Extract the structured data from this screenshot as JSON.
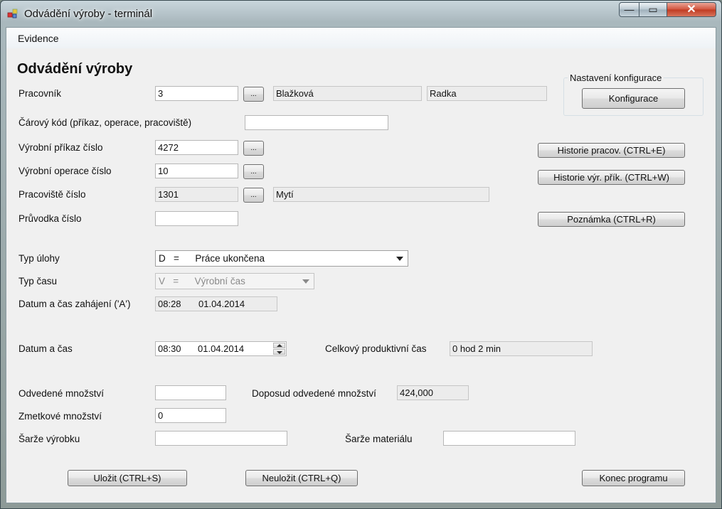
{
  "window": {
    "title": "Odvádění výroby - terminál",
    "controls": {
      "minimize": "—",
      "maximize": "▭",
      "close": "✕"
    },
    "icon": "app-window-icon"
  },
  "menu": {
    "items": [
      {
        "label": "Evidence"
      }
    ]
  },
  "form": {
    "title": "Odvádění výroby",
    "pracovnik": {
      "label": "Pracovník",
      "value": "3",
      "browse": "...",
      "surname": "Blažková",
      "first_name": "Radka"
    },
    "carovy_kod": {
      "label": "Čárový kód (příkaz, operace, pracoviště)",
      "value": ""
    },
    "vyrobni_prikaz": {
      "label": "Výrobní příkaz číslo",
      "value": "4272",
      "browse": "..."
    },
    "vyrobni_operace": {
      "label": "Výrobní operace číslo",
      "value": "10",
      "browse": "..."
    },
    "pracoviste": {
      "label": "Pracoviště číslo",
      "value": "1301",
      "browse": "...",
      "name": "Mytí"
    },
    "pruvodka": {
      "label": "Průvodka číslo",
      "value": ""
    },
    "typ_ulohy": {
      "label": "Typ úlohy",
      "value": "D   =      Práce ukončena"
    },
    "typ_casu": {
      "label": "Typ času",
      "value": "V   =      Výrobní čas"
    },
    "zahajeni": {
      "label": "Datum a čas zahájení ('A')",
      "time": "08:28",
      "date": "01.04.2014"
    },
    "datum_cas": {
      "label": "Datum a čas",
      "time": "08:30",
      "date": "01.04.2014"
    },
    "celkovy_cas": {
      "label": "Celkový produktivní čas",
      "value": "0 hod 2 min"
    },
    "odvedene_mnozstvi": {
      "label": "Odvedené množství",
      "value": ""
    },
    "doposud_odvedene": {
      "label": "Doposud odvedené množství",
      "value": "424,000"
    },
    "zmetkove_mnozstvi": {
      "label": "Zmetkové množství",
      "value": "0"
    },
    "sarze_vyrobku": {
      "label": "Šarže výrobku",
      "value": ""
    },
    "sarze_materialu": {
      "label": "Šarže materiálu",
      "value": ""
    }
  },
  "config_group": {
    "title": "Nastavení konfigurace",
    "button": "Konfigurace"
  },
  "side_buttons": {
    "historie_pracov": "Historie  pracov.  (CTRL+E)",
    "historie_vyr": "Historie výr. přík.  (CTRL+W)",
    "poznamka": "Poznámka  (CTRL+R)"
  },
  "footer": {
    "ulozit": "Uložit     (CTRL+S)",
    "neulozit": "Neuložit     (CTRL+Q)",
    "konec": "Konec programu"
  }
}
